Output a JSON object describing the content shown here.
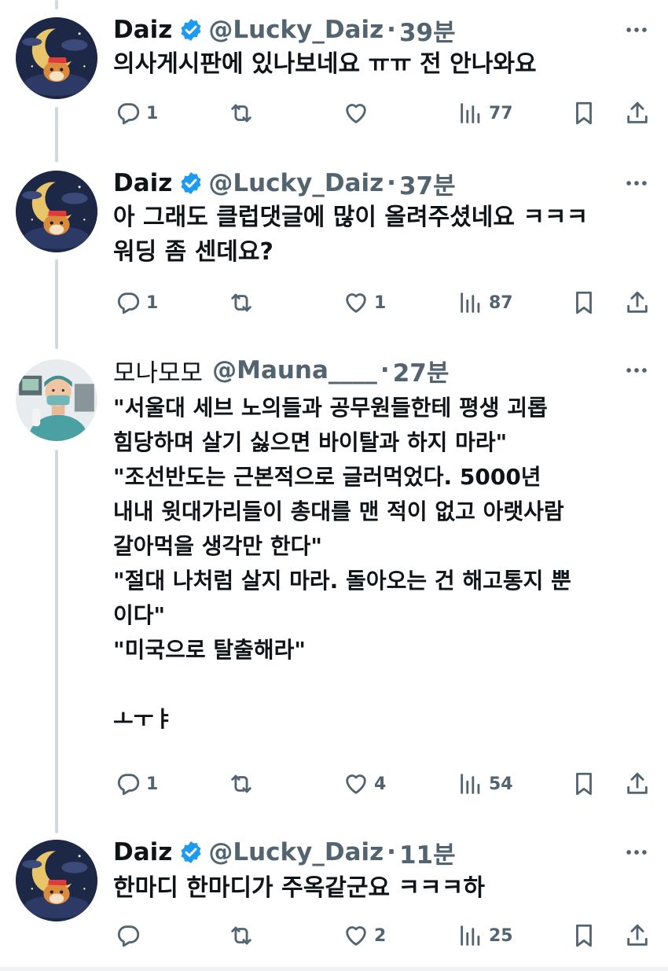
{
  "tweets": [
    {
      "name": "Daiz",
      "handle": "@Lucky_Daiz",
      "time": "39분",
      "avatar": "moon-shiba-avatar",
      "verified": true,
      "text": "의사게시판에 있나보네요 ㅠㅠ 전 안나와요",
      "replies": "1",
      "retweets": "",
      "likes": "",
      "views": "77"
    },
    {
      "name": "Daiz",
      "handle": "@Lucky_Daiz",
      "time": "37분",
      "avatar": "moon-shiba-avatar",
      "verified": true,
      "text": "아 그래도 클럽댓글에 많이 올려주셨네요 ㅋㅋㅋ\n워딩 좀 센데요?",
      "replies": "1",
      "retweets": "",
      "likes": "1",
      "views": "87"
    },
    {
      "name": "모나모모",
      "handle": "@Mauna____",
      "time": "27분",
      "avatar": "doctor-avatar",
      "verified": false,
      "text": "\"서울대 세브 노의들과 공무원들한테 평생 괴롭\n힘당하며 살기 싫으면 바이탈과 하지 마라\"\n\"조선반도는 근본적으로 글러먹었다. 5000년\n내내 윗대가리들이 총대를 맨 적이 없고 아랫사람\n갈아먹을 생각만 한다\"\n\"절대 나처럼 살지 마라. 돌아오는 건 해고통지 뿐\n이다\"\n\"미국으로 탈출해라\"\n\nㅗㅜㅑ",
      "replies": "1",
      "retweets": "",
      "likes": "4",
      "views": "54"
    },
    {
      "name": "Daiz",
      "handle": "@Lucky_Daiz",
      "time": "11분",
      "avatar": "moon-shiba-avatar",
      "verified": true,
      "text": "한마디 한마디가 주옥같군요 ㅋㅋㅋ하",
      "replies": "",
      "retweets": "",
      "likes": "2",
      "views": "25"
    }
  ],
  "colors": {
    "text": "#0f1419",
    "secondary": "#536471",
    "verified": "#1d9bf0",
    "thread_line": "#cfd9de"
  },
  "icons": [
    "reply-icon",
    "retweet-icon",
    "like-icon",
    "views-icon",
    "bookmark-icon",
    "share-icon",
    "more-icon",
    "verified-badge-icon"
  ]
}
